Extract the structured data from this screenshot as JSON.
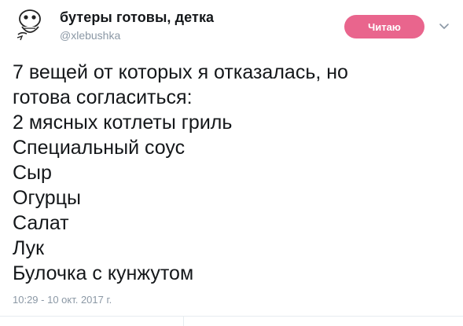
{
  "author": {
    "display_name": "бутеры готовы, детка",
    "handle": "@xlebushka",
    "avatar_icon": "rage-face-avatar-icon"
  },
  "follow_button": {
    "label": "Читаю",
    "color": "#e0245e"
  },
  "menu_icon": "chevron-down-icon",
  "tweet": {
    "lines": [
      "7 вещей от которых я отказалась, но",
      "готова согласиться:",
      "2 мясных котлеты гриль",
      "Специальный соус",
      "Сыр",
      "Огурцы",
      "Салат",
      "Лук",
      "Булочка с кунжутом"
    ],
    "timestamp": "10:29 - 10 окт. 2017 г."
  }
}
